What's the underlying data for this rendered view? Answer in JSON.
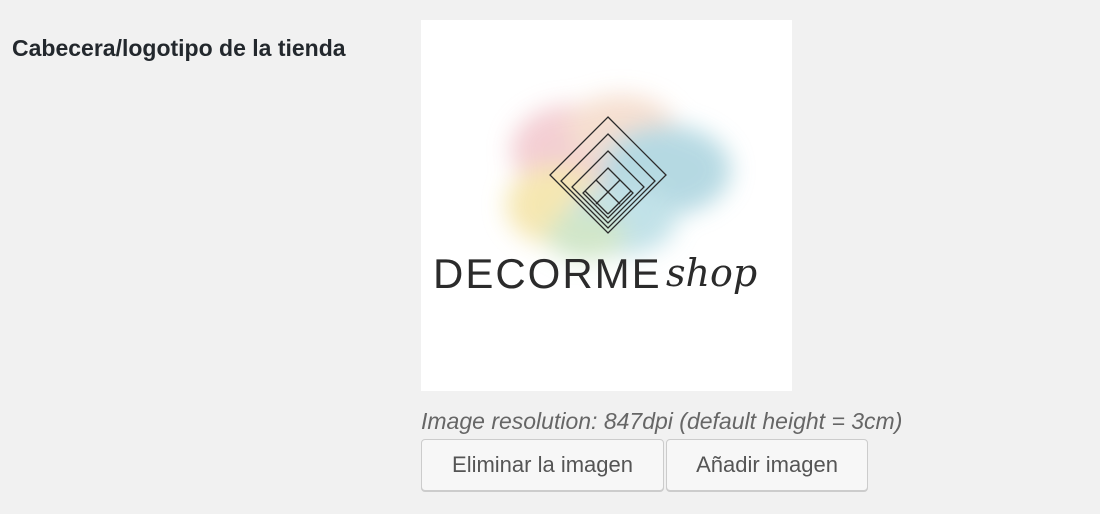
{
  "field": {
    "label": "Cabecera/logotipo de la tienda"
  },
  "logo": {
    "brand_text": "DECORME",
    "script_text": "shop",
    "icon": "diamond-grid-logo-icon"
  },
  "resolution_note": "Image resolution: 847dpi (default height = 3cm)",
  "buttons": {
    "remove_label": "Eliminar la imagen",
    "add_label": "Añadir imagen"
  },
  "colors": {
    "page_background": "#f1f1f1",
    "label_text": "#23282d",
    "note_text": "#666666",
    "button_background": "#f7f7f7",
    "button_border": "#cccccc",
    "watercolor_blue": "#a9d3de",
    "watercolor_yellow": "#f4e3a4",
    "watercolor_pink": "#f2c6cc"
  }
}
